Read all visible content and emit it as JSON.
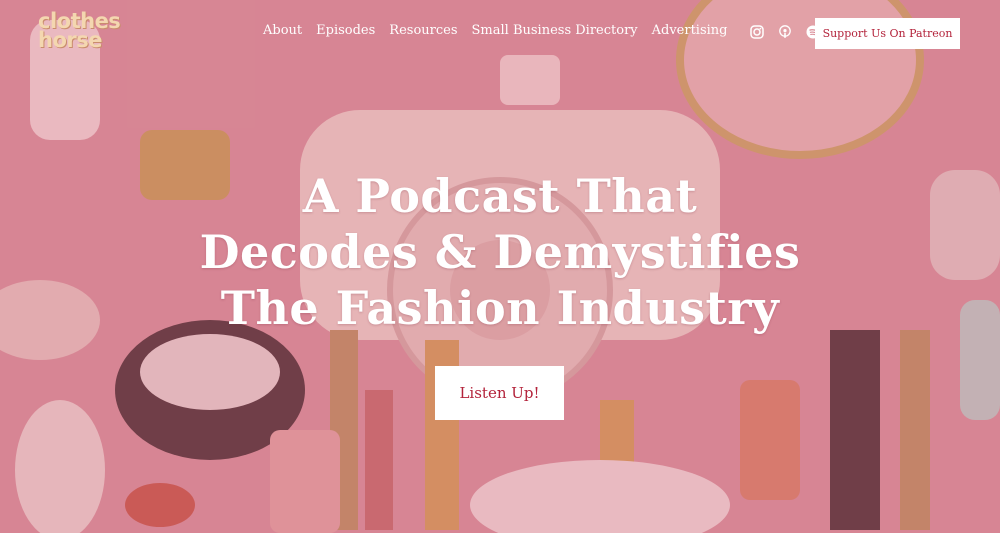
{
  "logo": {
    "line1": "clothes",
    "line2": "horse"
  },
  "nav": {
    "items": [
      {
        "label": "About"
      },
      {
        "label": "Episodes"
      },
      {
        "label": "Resources"
      },
      {
        "label": "Small Business Directory"
      },
      {
        "label": "Advertising"
      }
    ],
    "social_icons": [
      "instagram-icon",
      "apple-podcasts-icon",
      "spotify-icon",
      "stitcher-icon"
    ],
    "patreon_label": "Support Us On Patreon"
  },
  "hero": {
    "title_lines": [
      "A Podcast That",
      "Decodes & Demystifies",
      "The Fashion Industry"
    ],
    "cta_label": "Listen Up!"
  },
  "colors": {
    "accent": "#b3233b",
    "overlay_pink": "#d98a95",
    "logo": "#f4d7b0"
  }
}
